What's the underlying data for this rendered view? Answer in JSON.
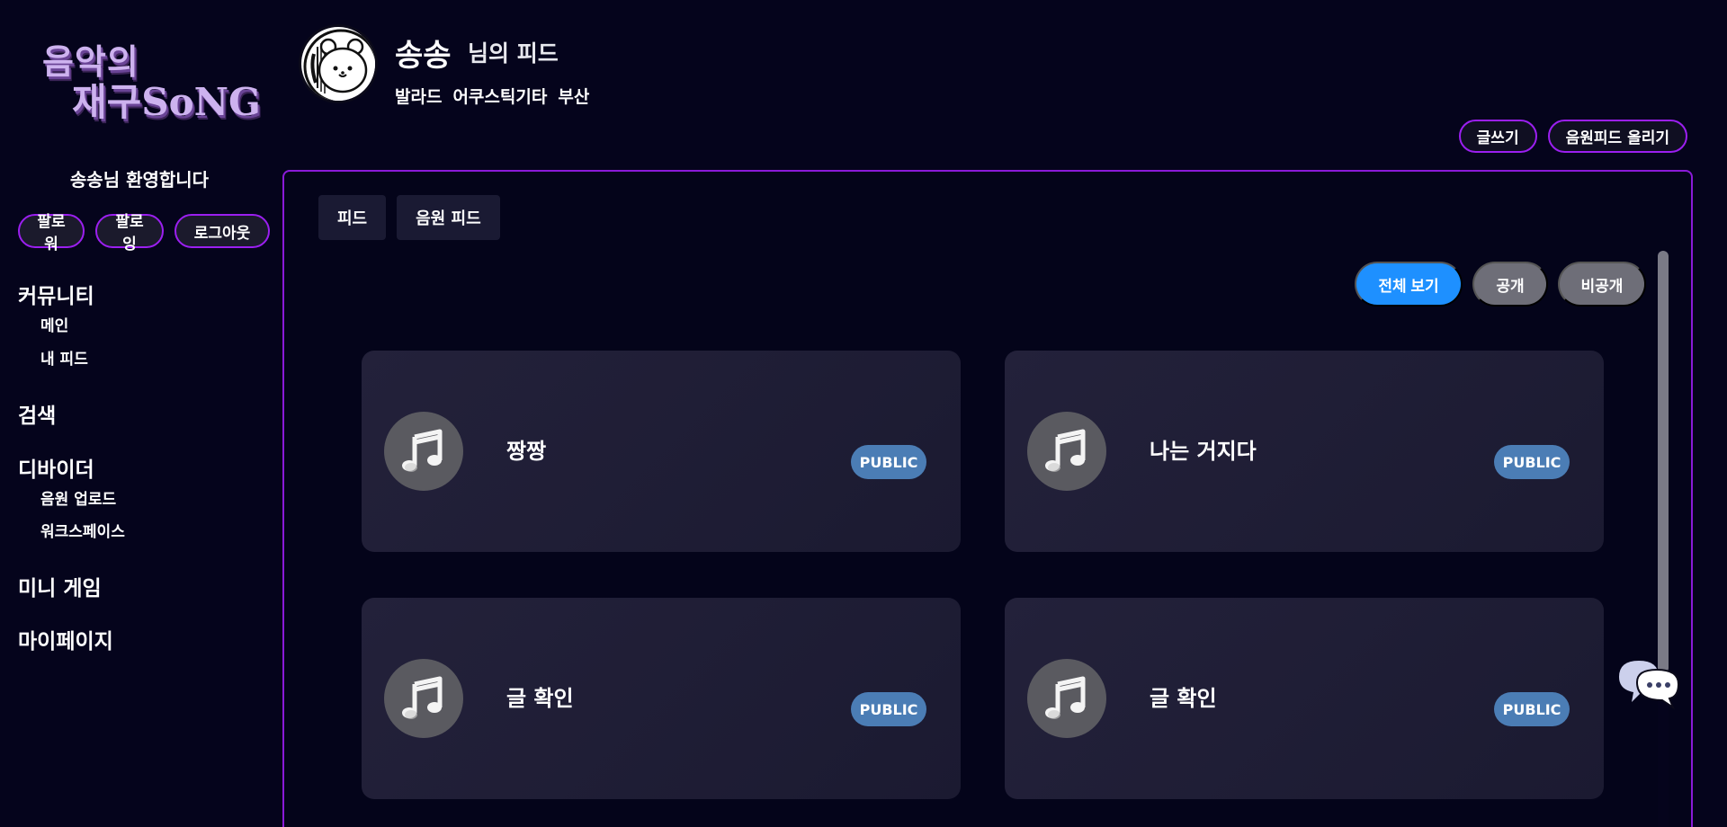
{
  "logo": {
    "line1": "음악의",
    "line2": "재구SoNG"
  },
  "sidebar": {
    "welcome": "송송님 환영합니다",
    "buttons": {
      "follower": "팔로워",
      "following": "팔로잉",
      "logout": "로그아웃"
    },
    "nav": {
      "community": "커뮤니티",
      "main": "메인",
      "my_feed": "내 피드",
      "search": "검색",
      "divider": "디바이더",
      "upload": "음원 업로드",
      "workspace": "워크스페이스",
      "mini_game": "미니 게임",
      "mypage": "마이페이지"
    }
  },
  "header": {
    "user_name": "송송",
    "feed_suffix": "님의 피드",
    "tags": [
      "발라드",
      "어쿠스틱기타",
      "부산"
    ]
  },
  "actions": {
    "write": "글쓰기",
    "upload_feed": "음원피드 올리기"
  },
  "tabs": {
    "feed": "피드",
    "music_feed": "음원 피드"
  },
  "filters": {
    "all": "전체 보기",
    "public": "공개",
    "private": "비공개"
  },
  "cards": [
    {
      "title": "짱짱",
      "badge": "PUBLIC"
    },
    {
      "title": "나는 거지다",
      "badge": "PUBLIC"
    },
    {
      "title": "글 확인",
      "badge": "PUBLIC"
    },
    {
      "title": "글 확인",
      "badge": "PUBLIC"
    }
  ],
  "colors": {
    "background": "#05041c",
    "accent_border": "#9b1ff0",
    "filter_active": "#1e90ff",
    "filter_inactive": "#6e6e78",
    "badge": "#4b7db5",
    "card": "#1f1e35"
  }
}
